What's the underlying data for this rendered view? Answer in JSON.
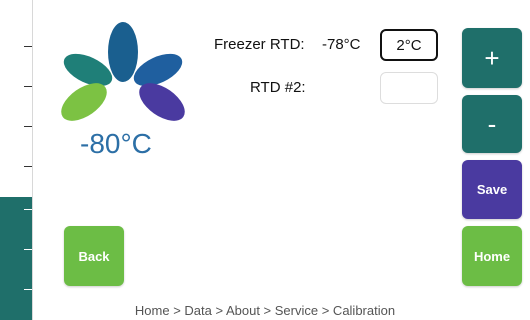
{
  "display": {
    "current_temp": "-80°C"
  },
  "readings": [
    {
      "label": "Freezer RTD:",
      "value": "-78°C",
      "offset": "2°C"
    },
    {
      "label": "RTD #2:",
      "value": "",
      "offset": ""
    }
  ],
  "buttons": {
    "plus": "+",
    "minus": "-",
    "save": "Save",
    "back": "Back",
    "home": "Home"
  },
  "breadcrumb": "Home > Data > About > Service > Calibration",
  "colors": {
    "teal": "#1f6f6a",
    "purple": "#4a3aa0",
    "green": "#6cbd45",
    "temp_text": "#2c6fa6"
  }
}
